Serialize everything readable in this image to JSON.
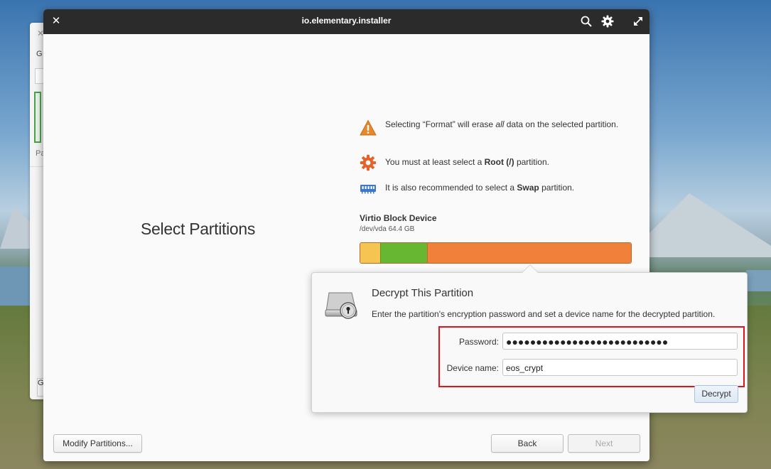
{
  "window": {
    "title": "io.elementary.installer",
    "close_glyph": "✕"
  },
  "page": {
    "title": "Select Partitions"
  },
  "messages": [
    {
      "icon": "warning-icon",
      "html_parts": [
        "Selecting “Format” will erase ",
        "all",
        " data on the selected partition."
      ]
    },
    {
      "icon": "gear-icon",
      "html_parts": [
        "You must at least select a ",
        "Root (/)",
        " partition."
      ]
    },
    {
      "icon": "memory-icon",
      "html_parts": [
        "It is also recommended to select a ",
        "Swap",
        " partition."
      ]
    }
  ],
  "device": {
    "name": "Virtio Block Device",
    "info": "/dev/vda 64.4 GB",
    "segments": [
      {
        "fraction": 0.075,
        "color": "#f5c451"
      },
      {
        "fraction": 0.17,
        "color": "#68b732"
      },
      {
        "fraction": 0.755,
        "color": "#f0803a"
      }
    ]
  },
  "popover": {
    "title": "Decrypt This Partition",
    "description": "Enter the partition's encryption password and set a device name for the decrypted partition.",
    "password_label": "Password:",
    "password_value": "●●●●●●●●●●●●●●●●●●●●●●●●●●●",
    "device_label": "Device name:",
    "device_value": "eos_crypt",
    "decrypt_label": "Decrypt"
  },
  "buttons": {
    "modify": "Modify Partitions...",
    "back": "Back",
    "next": "Next"
  },
  "colors": {
    "titlebar": "#2b2b2b",
    "highlight": "#e0141c",
    "warning": "#e5892a",
    "gear": "#e5632a",
    "memory": "#3a78c8"
  }
}
